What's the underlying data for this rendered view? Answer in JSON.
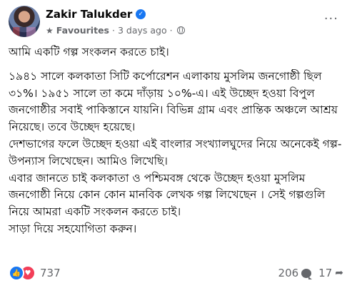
{
  "post": {
    "author": "Zakir Talukder",
    "audience_label": "Favourites",
    "timestamp": "3 days ago",
    "separator": "·",
    "more_label": "···",
    "paragraphs": [
      "আমি একটি গল্প সংকলন করতে চাই।",
      "১৯৪১ সালে কলকাতা সিটি কর্পোরেশন এলাকায় মুসলিম জনগোষ্ঠী ছিল ৩১%। ১৯৫১ সালে তা কমে দাঁড়ায় ১০%-এ। এই উচ্ছেদ হওয়া বিপুল জনগোষ্ঠীর সবাই পাকিস্তানে যায়নি। বিভিন্ন গ্রাম এবং প্রান্তিক অঞ্চলে আশ্রয় নিয়েছে। তবে উচ্ছেদ হয়েছে।",
      "দেশভাগের ফলে উচ্ছেদ হওয়া এই বাংলার সংখ্যালঘুদের নিয়ে অনেকেই গল্প-উপন্যাস লিখেছেন। আমিও লিখেছি।",
      "এবার জানতে চাই কলকাতা ও পশ্চিমবঙ্গ থেকে উচ্ছেদ হওয়া মুসলিম জনগোষ্ঠী নিয়ে কোন কোন মানবিক লেখক গল্প লিখেছেন । সেই গল্পগুলি নিয়ে আমরা একটি সংকলন করতে চাই।",
      "সাড়া দিয়ে সহযোগিতা করুন।"
    ]
  },
  "footer": {
    "reaction_count": "737",
    "comment_count": "206",
    "share_count": "17"
  },
  "icons": {
    "verified": "verified-badge-icon",
    "audience": "star-icon",
    "privacy": "globe-icon",
    "like": "like-icon",
    "love": "love-icon",
    "comment": "comment-icon",
    "share": "share-icon"
  },
  "colors": {
    "accent": "#1877f2",
    "love": "#f33e58",
    "muted": "#65676b"
  }
}
